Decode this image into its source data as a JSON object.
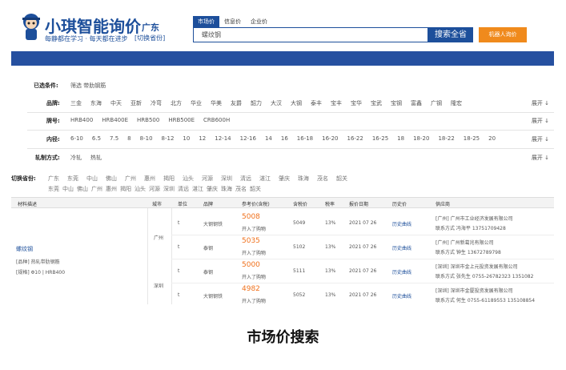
{
  "header": {
    "logo_title": "小琪智能询价",
    "logo_slogan": "每静都在学习 · 每天都在进步",
    "region": "广东",
    "region_switch": "[切换省份]",
    "search_tabs": [
      "市场价",
      "信息价",
      "企业价"
    ],
    "search_value": "螺纹钢",
    "search_button": "搜索全省",
    "robot_button": "机器人询价"
  },
  "filters": {
    "selected": {
      "label": "已选条件:",
      "value": "筛选 带肋钢筋"
    },
    "brand": {
      "label": "品牌:",
      "options": [
        "三金",
        "东海",
        "中天",
        "亚新",
        "冷弯",
        "北方",
        "华业",
        "华美",
        "友爵",
        "韶力",
        "大汉",
        "大钢",
        "泰丰",
        "宝丰",
        "宝华",
        "宝武",
        "宝钢",
        "富鑫",
        "广钢",
        "隆宏"
      ],
      "expand": "展开 ↓"
    },
    "grade": {
      "label": "牌号:",
      "options": [
        "HRB400",
        "HRB400E",
        "HRB500",
        "HRB500E",
        "CRB600H"
      ],
      "expand": "展开 ↓"
    },
    "spec": {
      "label": "内径:",
      "options": [
        "6-10",
        "6.5",
        "7.5",
        "8",
        "8-10",
        "8-12",
        "10",
        "12",
        "12-14",
        "12-16",
        "14",
        "16",
        "16-18",
        "16-20",
        "16-22",
        "16-25",
        "18",
        "18-20",
        "18-22",
        "18-25",
        "20"
      ],
      "expand": "展开 ↓"
    },
    "method": {
      "label": "轧制方式:",
      "options": [
        "冷轧",
        "热轧"
      ],
      "expand": "展开 ↓"
    },
    "switch_city": {
      "label": "切换省份:",
      "row1": [
        "广东",
        "东莞",
        "中山",
        "佛山",
        "广州",
        "惠州",
        "揭阳",
        "汕头",
        "河源",
        "深圳",
        "清远",
        "湛江",
        "肇庆",
        "珠海",
        "茂名",
        "韶关"
      ],
      "row2": [
        "东莞",
        "中山",
        "佛山",
        "广州",
        "惠州",
        "揭阳",
        "汕头",
        "河源",
        "深圳",
        "清远",
        "湛江",
        "肇庆",
        "珠海",
        "茂名",
        "韶关"
      ]
    }
  },
  "table": {
    "headers": [
      "材料描述",
      "城市",
      "单位",
      "品牌",
      "参考价(含税)",
      "含税价",
      "税率",
      "报价日期",
      "历史价",
      "供应商"
    ],
    "product": {
      "name": "螺纹钢",
      "category": "[品种] 热轧带肋钢筋",
      "spec": "[规格] Φ10 | HRB400"
    },
    "cities": [
      "广州",
      "深圳"
    ],
    "rows": [
      {
        "unit": "t",
        "brand": "大钢钢铁",
        "price": "5008",
        "price_note": "开入了购物",
        "tax_price": "5049",
        "tax": "13%",
        "date": "2021 07 26",
        "history": "历史曲线",
        "supplier": "[广州] 广州市工业经济发展有限公司",
        "contact": "联系方式 冯海平 13751709428"
      },
      {
        "unit": "t",
        "brand": "泰钢",
        "price": "5035",
        "price_note": "开入了购物",
        "tax_price": "5102",
        "tax": "13%",
        "date": "2021 07 26",
        "history": "历史曲线",
        "supplier": "[广州] 广州新葛兆有限公司",
        "contact": "联系方式 钟生 13672789798"
      },
      {
        "unit": "t",
        "brand": "泰钢",
        "price": "5000",
        "price_note": "开入了购物",
        "tax_price": "5111",
        "tax": "13%",
        "date": "2021 07 26",
        "history": "历史曲线",
        "supplier": "[深圳] 深圳市金上元投资发展有限公司",
        "contact": "联系方式 张先生 0755-26782323 1351082"
      },
      {
        "unit": "t",
        "brand": "大钢钢铁",
        "price": "4982",
        "price_note": "开入了购物",
        "tax_price": "5052",
        "tax": "13%",
        "date": "2021 07 26",
        "history": "历史曲线",
        "supplier": "[深圳] 深圳市金厦投资发展有限公司",
        "contact": "联系方式 何生 0755-61189553 135108854"
      }
    ]
  },
  "caption": "市场价搜索",
  "colors": {
    "brand_blue": "#1d4f9b",
    "nav_blue": "#2650a0",
    "orange": "#f08a1c",
    "price": "#f0711c"
  }
}
